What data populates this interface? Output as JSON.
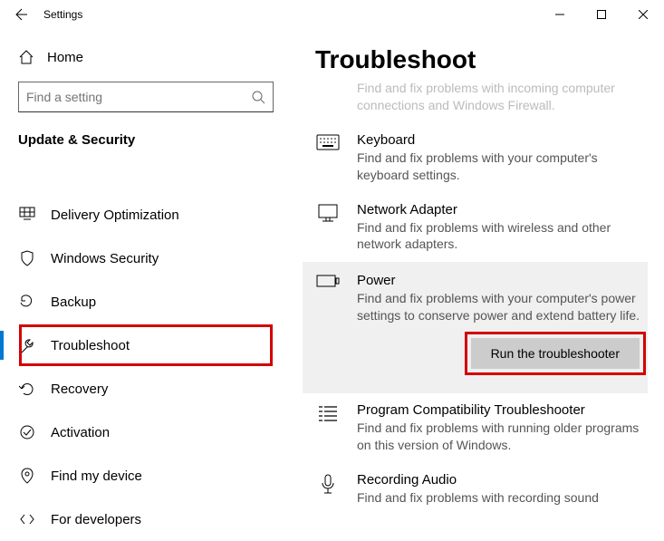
{
  "window": {
    "title": "Settings"
  },
  "home": {
    "label": "Home"
  },
  "search": {
    "placeholder": "Find a setting"
  },
  "section_header": "Update & Security",
  "nav": [
    {
      "id": "delivery-optimization",
      "label": "Delivery Optimization"
    },
    {
      "id": "windows-security",
      "label": "Windows Security"
    },
    {
      "id": "backup",
      "label": "Backup"
    },
    {
      "id": "troubleshoot",
      "label": "Troubleshoot",
      "selected": true
    },
    {
      "id": "recovery",
      "label": "Recovery"
    },
    {
      "id": "activation",
      "label": "Activation"
    },
    {
      "id": "find-my-device",
      "label": "Find my device"
    },
    {
      "id": "for-developers",
      "label": "For developers"
    }
  ],
  "page": {
    "title": "Troubleshoot"
  },
  "ts": {
    "incoming": {
      "desc": "Find and fix problems with incoming computer connections and Windows Firewall."
    },
    "keyboard": {
      "title": "Keyboard",
      "desc": "Find and fix problems with your computer's keyboard settings."
    },
    "network": {
      "title": "Network Adapter",
      "desc": "Find and fix problems with wireless and other network adapters."
    },
    "power": {
      "title": "Power",
      "desc": "Find and fix problems with your computer's power settings to conserve power and extend battery life.",
      "run_label": "Run the troubleshooter"
    },
    "compat": {
      "title": "Program Compatibility Troubleshooter",
      "desc": "Find and fix problems with running older programs on this version of Windows."
    },
    "audio": {
      "title": "Recording Audio",
      "desc": "Find and fix problems with recording sound"
    }
  }
}
